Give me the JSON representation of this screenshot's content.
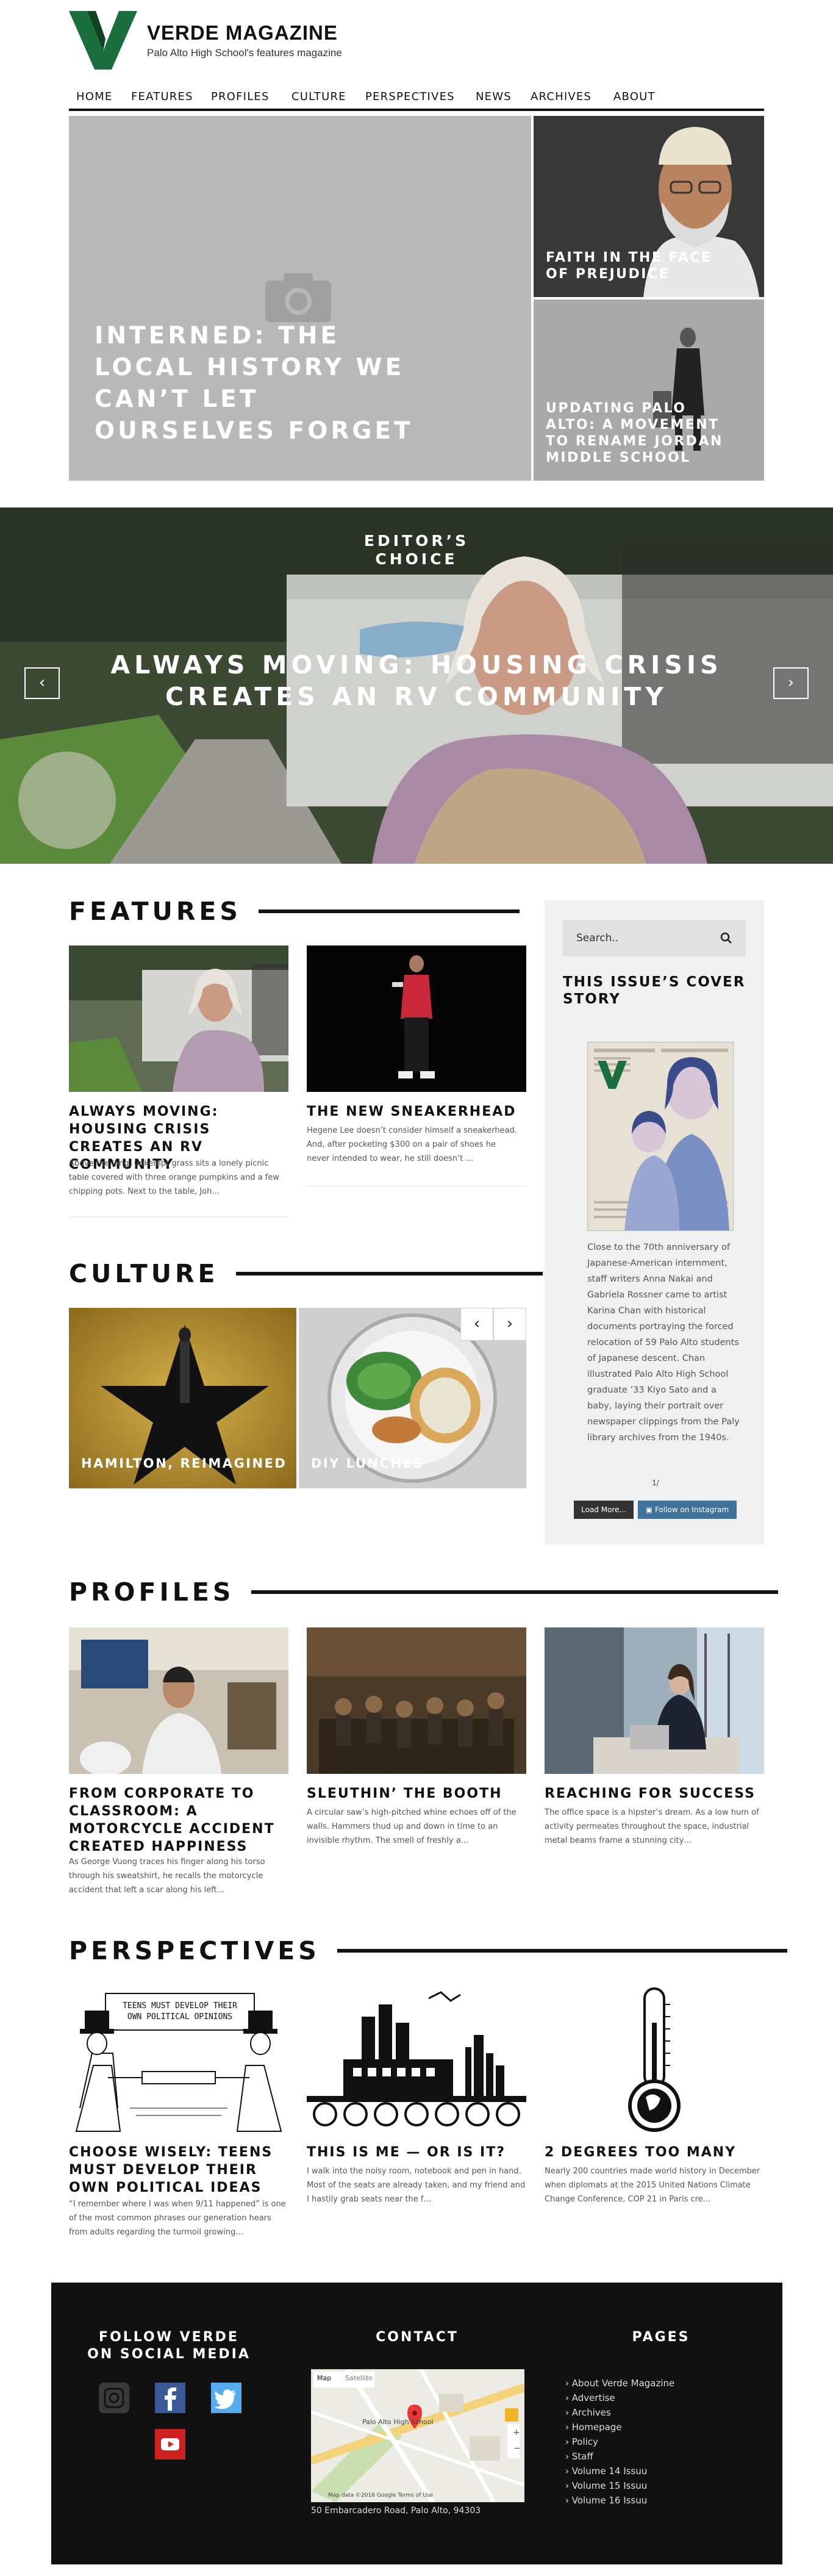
{
  "brand": {
    "name": "VERDE MAGAZINE",
    "tagline": "Palo Alto High School's features magazine",
    "colors": {
      "logo_green": "#1b6e3e",
      "footer": "#111111",
      "instagram_blue": "#3f729b"
    }
  },
  "nav": {
    "items": [
      "HOME",
      "FEATURES",
      "PROFILES",
      "CULTURE",
      "PERSPECTIVES",
      "NEWS",
      "ARCHIVES",
      "ABOUT"
    ]
  },
  "hero": {
    "main_title": "INTERNED: THE LOCAL HISTORY WE CAN’T LET OURSELVES FORGET",
    "tile_1_title": "FAITH IN THE FACE OF PREJUDICE",
    "tile_2_title": "UPDATING PALO ALTO: A MOVEMENT TO RENAME JORDAN MIDDLE SCHOOL"
  },
  "slider": {
    "kicker": "EDITOR’S CHOICE",
    "title": "ALWAYS MOVING: HOUSING CRISIS CREATES AN RV COMMUNITY",
    "prev_icon": "‹",
    "next_icon": "›"
  },
  "features": {
    "heading": "FEATURES",
    "cards": [
      {
        "title": "ALWAYS MOVING: HOUSING CRISIS CREATES AN RV COMMUNITY",
        "excerpt": "Above the long, unkempt grass sits a lonely picnic table covered with three orange pumpkins and a few chipping pots.  Next to the table, Joh…"
      },
      {
        "title": "THE NEW SNEAKERHEAD",
        "excerpt": "Hegene Lee doesn’t consider himself a sneakerhead. And, after pocketing $300 on a pair of shoes he never intended to wear, he still doesn’t …"
      }
    ]
  },
  "sidebar": {
    "search_placeholder": "Search..",
    "cover_heading": "THIS ISSUE’S COVER STORY",
    "cover_text": "Close to the 70th anniversary of Japanese-American internment, staff writers Anna Nakai and Gabriela Rossner came to artist Karina Chan with historical documents portraying the forced relocation of 59 Palo Alto students of Japanese descent. Chan illustrated Palo Alto High School graduate ’33 Kiyo Sato and a baby, laying their portrait over newspaper clippings from the Paly library archives from the 1940s.",
    "dots": "1/",
    "load_more": "Load More...",
    "follow": "Follow on Instagram"
  },
  "culture": {
    "heading": "CULTURE",
    "tiles": [
      {
        "title": "HAMILTON, REIMAGINED"
      },
      {
        "title": "DIY LUNCHES"
      }
    ],
    "prev_icon": "‹",
    "next_icon": "›"
  },
  "profiles": {
    "heading": "PROFILES",
    "cards": [
      {
        "title": "FROM CORPORATE TO CLASSROOM: A MOTORCYCLE ACCIDENT CREATED HAPPINESS",
        "excerpt": "As George Vuong traces his finger along his torso through his sweatshirt, he recalls the motorcycle accident that left a scar along his left…"
      },
      {
        "title": "SLEUTHIN’ THE BOOTH",
        "excerpt": "A circular saw’s high-pitched whine echoes off of the walls. Hammers thud up and down in time to an invisible rhythm. The smell of freshly a…"
      },
      {
        "title": "REACHING FOR SUCCESS",
        "excerpt": "The office space is a hipster’s dream. As a low hum of activity permeates throughout the space, industrial metal beams frame a stunning city…"
      }
    ]
  },
  "perspectives": {
    "heading": "PERSPECTIVES",
    "banner_text": "TEENS MUST DEVELOP THEIR OWN POLITICAL OPINIONS",
    "cards": [
      {
        "title": "CHOOSE WISELY: TEENS MUST DEVELOP THEIR OWN POLITICAL IDEAS",
        "excerpt": "“I remember where I was when 9/11 happened” is one of the most common phrases our generation hears from adults regarding the turmoil growing…"
      },
      {
        "title": "THIS IS ME — OR IS IT?",
        "excerpt": "I walk into the noisy room, notebook and pen in hand. Most of the seats are already taken, and my friend and I hastily grab seats near the f…"
      },
      {
        "title": "2 DEGREES TOO MANY",
        "excerpt": "Nearly 200 countries made world history in December when diplomats at the 2015 United Nations Climate Change Conference, COP 21 in Paris cre…"
      }
    ]
  },
  "footer": {
    "social_heading": "FOLLOW VERDE ON SOCIAL MEDIA",
    "contact_heading": "CONTACT",
    "pages_heading": "PAGES",
    "address": "50 Embarcadero Road, Palo Alto, 94303",
    "map_tabs": [
      "Map",
      "Satellite"
    ],
    "map_place": "Palo Alto High School",
    "map_footer": "Map data ©2016 Google   Terms of Use",
    "pages": [
      "About Verde Magazine",
      "Advertise",
      "Archives",
      "Homepage",
      "Policy",
      "Staff",
      "Volume 14 Issuu",
      "Volume 15 Issuu",
      "Volume 16 Issuu"
    ],
    "bullet": "›"
  }
}
